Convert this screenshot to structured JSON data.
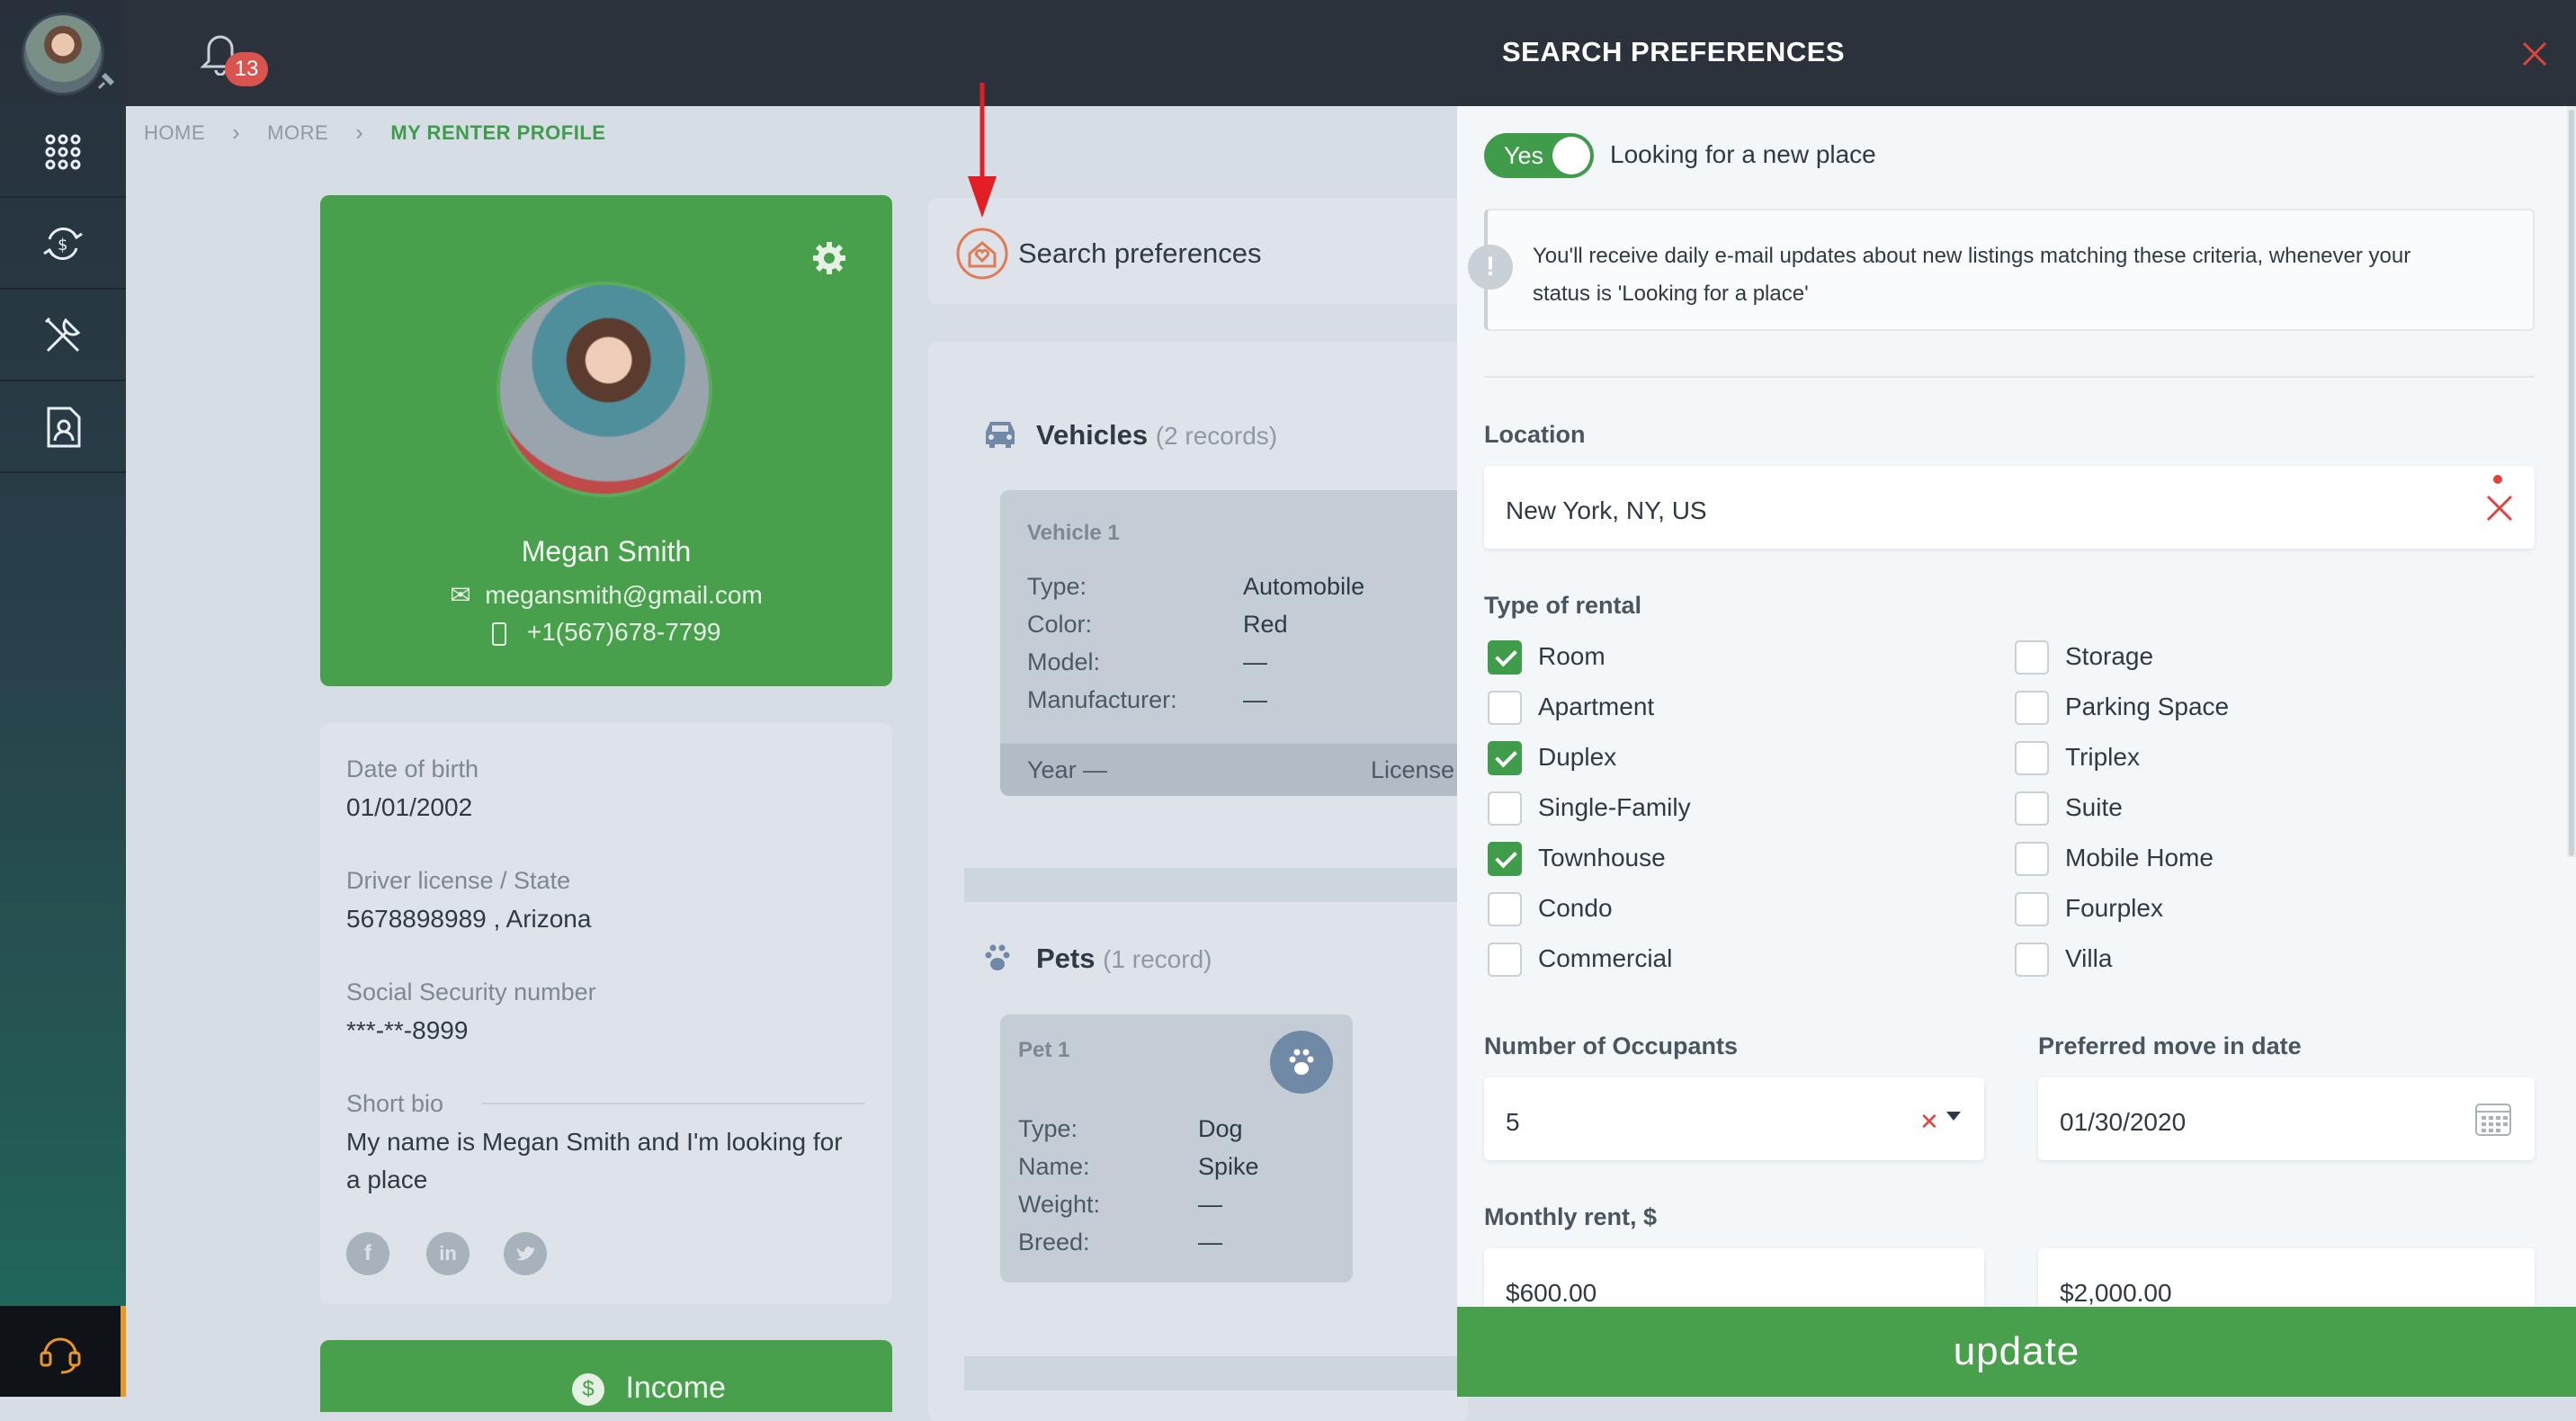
{
  "notifications": {
    "count": "13"
  },
  "breadcrumb": {
    "home": "HOME",
    "more": "MORE",
    "current": "MY RENTER PROFILE"
  },
  "profile": {
    "name": "Megan Smith",
    "email": "megansmith@gmail.com",
    "phone": "+1(567)678-7799"
  },
  "info": {
    "dob_label": "Date of birth",
    "dob": "01/01/2002",
    "license_label": "Driver license / State",
    "license": "5678898989 , Arizona",
    "ssn_label": "Social Security number",
    "ssn": "***-**-8999",
    "bio_label": "Short bio",
    "bio_line1": "My name is Megan Smith and I'm looking for",
    "bio_line2": "a place"
  },
  "income_label": "Income",
  "search_tab": {
    "label": "Search preferences"
  },
  "vehicles": {
    "title": "Vehicles",
    "count": "(2 records)",
    "card_title": "Vehicle 1",
    "fields": [
      {
        "k": "Type:",
        "v": "Automobile"
      },
      {
        "k": "Color:",
        "v": "Red"
      },
      {
        "k": "Model:",
        "v": "—"
      },
      {
        "k": "Manufacturer:",
        "v": "—"
      }
    ],
    "footer_year": "Year —",
    "footer_license": "License"
  },
  "pets": {
    "title": "Pets",
    "count": "(1 record)",
    "card_title": "Pet 1",
    "fields": [
      {
        "k": "Type:",
        "v": "Dog"
      },
      {
        "k": "Name:",
        "v": "Spike"
      },
      {
        "k": "Weight:",
        "v": "—"
      },
      {
        "k": "Breed:",
        "v": "—"
      }
    ]
  },
  "panel": {
    "title": "SEARCH PREFERENCES",
    "toggle_label": "Yes",
    "toggle_on": true,
    "looking_label": "Looking for a new place",
    "note_line1": "You'll receive daily e-mail updates about new listings matching these criteria, whenever your",
    "note_line2": "status is 'Looking for a place'",
    "location_label": "Location",
    "location_value": "New York, NY, US",
    "rental_label": "Type of rental",
    "rental_left": [
      {
        "label": "Room",
        "checked": true
      },
      {
        "label": "Apartment",
        "checked": false
      },
      {
        "label": "Duplex",
        "checked": true
      },
      {
        "label": "Single-Family",
        "checked": false
      },
      {
        "label": "Townhouse",
        "checked": true
      },
      {
        "label": "Condo",
        "checked": false
      },
      {
        "label": "Commercial",
        "checked": false
      }
    ],
    "rental_right": [
      {
        "label": "Storage",
        "checked": false
      },
      {
        "label": "Parking Space",
        "checked": false
      },
      {
        "label": "Triplex",
        "checked": false
      },
      {
        "label": "Suite",
        "checked": false
      },
      {
        "label": "Mobile Home",
        "checked": false
      },
      {
        "label": "Fourplex",
        "checked": false
      },
      {
        "label": "Villa",
        "checked": false
      }
    ],
    "occupants_label": "Number of Occupants",
    "occupants_value": "5",
    "movein_label": "Preferred move in date",
    "movein_value": "01/30/2020",
    "rent_label": "Monthly rent, $",
    "rent_min": "$600.00",
    "rent_max": "$2,000.00",
    "update_label": "update"
  },
  "colors": {
    "accent": "#49a04c",
    "danger": "#d9534f",
    "dark": "#2b323b"
  }
}
